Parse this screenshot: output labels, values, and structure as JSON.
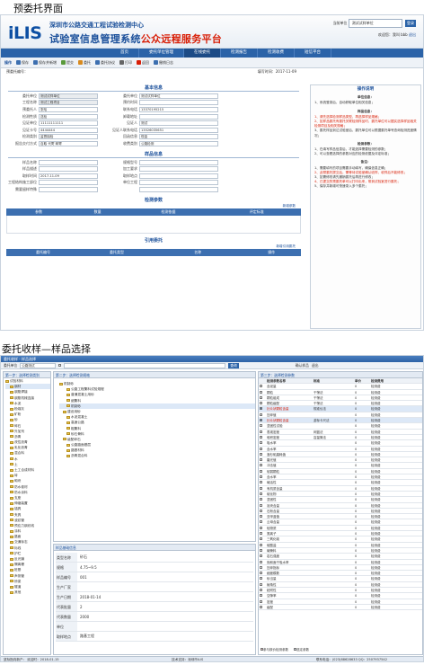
{
  "captions": {
    "screen1": "预委托界面",
    "screen2": "委托收样—样品选择"
  },
  "screen1": {
    "org_line1": "深圳市公路交通工程试验检测中心",
    "org_line2_a": "试验室信息管理系统",
    "org_line2_b": "公众远程服务平台",
    "logo": "iLIS",
    "topright": {
      "unit_label": "当前单位",
      "unit_value": "测试试样单位",
      "login_label": "登录",
      "user": "欢迎您：我叫 bbb",
      "logout": "退出"
    },
    "nav": [
      "首页",
      "委托单位管理",
      "在线委托",
      "检测报告",
      "检测收费",
      "短信平台"
    ],
    "toolbar": {
      "label": "操作",
      "buttons": [
        "保存",
        "保存并新增",
        "提交",
        "委托",
        "委托协议",
        "打印",
        "返回",
        "撤销日志"
      ]
    },
    "subbar": {
      "left_label": "预委托编号：",
      "right_label": "填写时间：",
      "right_value": "2017-11-09"
    },
    "basic": {
      "title": "基本信息",
      "rows": [
        [
          {
            "l": "委托单位",
            "v": "测试试样单位",
            "g": true
          },
          {
            "l": "委托单位",
            "v": "测试试样单位"
          }
        ],
        [
          {
            "l": "工程名称",
            "v": "测试工程项目",
            "g": true
          },
          {
            "l": "预约时间",
            "v": ""
          }
        ],
        [
          {
            "l": "预委托人",
            "v": "张哈"
          },
          {
            "l": "联系电话",
            "v": "13370195215"
          }
        ],
        [
          {
            "l": "检测性质",
            "v": "送检"
          },
          {
            "l": "卸载地址",
            "v": ""
          }
        ],
        [
          {
            "l": "见证单位",
            "v": "11111111111"
          },
          {
            "l": "见证人",
            "v": "测试"
          }
        ],
        [
          {
            "l": "见证卡号",
            "v": "4444444"
          },
          {
            "l": "见证人联系电话",
            "v": "13526035651"
          }
        ],
        [
          {
            "l": "检测类别",
            "v": "监督抽检"
          },
          {
            "l": "回函信息",
            "v": "现金"
          }
        ],
        [
          {
            "l": "报告交付方式",
            "v": "自取  代寄  邮寄"
          },
          {
            "l": "收费类别",
            "v": "公路检测"
          }
        ]
      ]
    },
    "sample": {
      "title": "样品信息",
      "rows": [
        [
          {
            "l": "样品名称",
            "v": ""
          },
          {
            "l": "规格型号",
            "v": ""
          }
        ],
        [
          {
            "l": "样品描述",
            "v": ""
          },
          {
            "l": "加工要求",
            "v": ""
          }
        ],
        [
          {
            "l": "取样时间",
            "v": "2017-11-09"
          },
          {
            "l": "取样地点",
            "v": ""
          }
        ],
        [
          {
            "l": "工程结构施工部位",
            "v": ""
          },
          {
            "l": "单位工程",
            "v": ""
          }
        ],
        [
          {
            "l": "需要留样特殊",
            "v": ""
          },
          {
            "l": "",
            "v": ""
          }
        ]
      ]
    },
    "params": {
      "title": "检测参数",
      "add": "新增参数",
      "headers": [
        "参数",
        "数量",
        "检测依据",
        "评定标准"
      ]
    },
    "refer": {
      "title": "引用委托",
      "add": "新增引用委托",
      "headers": [
        "委托编号",
        "委托类型",
        "名称",
        "操作"
      ]
    },
    "help": {
      "title": "操作说明",
      "sections": [
        {
          "t": "单位信息：",
          "lines": [
            {
              "x": "1、系统登录后，自动获取单位相关信息；",
              "r": false
            }
          ]
        },
        {
          "t": "样品信息：",
          "lines": [
            {
              "x": "1、请先选择检测样品类型，再选择样品规格；",
              "r": true
            },
            {
              "x": "2、如样品委托有委托关联检测样品时，委托单位可以据实选择样品相关检测项目及相关规格；",
              "r": true
            },
            {
              "x": "3、委托样品到达试验室后，委托单位可以根据委托单号查询检测进度情况；",
              "r": false
            }
          ]
        },
        {
          "t": "检测参数：",
          "lines": [
            {
              "x": "1、在填写样品信息后，才能选择需要检测的参数；",
              "r": false
            },
            {
              "x": "2、可以查看选择的参数对应的检测依据及评定标准；",
              "r": false
            }
          ]
        },
        {
          "t": "备注：",
          "lines": [
            {
              "x": "1、需要填写的项目需要手动填写，确保信息正确；",
              "r": false
            },
            {
              "x": "2、此预委托提交后，需等待试验室确认收样，收样后不能修改；",
              "r": true
            },
            {
              "x": "3、如需修改请先撤销委托后再进行修改；",
              "r": false
            },
            {
              "x": "4、已提交的预委托单可以打印出来，带到试验室进行委托；",
              "r": true
            },
            {
              "x": "5、保存并新增可快速录入多个委托；",
              "r": false
            }
          ]
        }
      ]
    }
  },
  "screen2": {
    "title": "委托收样 - 样品选择",
    "bar": {
      "unit_label": "委托单位",
      "unit": "公路测试",
      "search_btn": "查询",
      "confirm": "确认样品",
      "exit": "退出"
    },
    "pane1": {
      "title": "第一步：选择检测类别",
      "items": [
        "试验材料",
        "钢材",
        "钢筋焊接",
        "钢筋机械连接",
        "水泥",
        "粉煤灰",
        "矿粉",
        "砂",
        "碎石",
        "外加剂",
        "沥青",
        "改性沥青",
        "乳化沥青",
        "混合料",
        "水",
        "土",
        "土工合成材料",
        "砖",
        "砌块",
        "防水卷材",
        "防水涂料",
        "支座",
        "伸缩装置",
        "锚具",
        "夹具",
        "波纹管",
        "预应力钢绞线",
        "涂料",
        "路面",
        "交通标志",
        "标线",
        "护栏",
        "反光膜",
        "隔离栅",
        "桩基",
        "声测管",
        "桥梁",
        "隧道",
        "其他"
      ]
    },
    "pane2": {
      "title": "第二步：选择检测规格",
      "items": [
        "机制砂",
        "公路工程集料试验规程",
        "普通混凝土用砂",
        "细集料",
        "机制砂",
        "建设用砂",
        "水泥混凝土",
        "高速公路",
        "粗集料",
        "砂石骨料",
        "级配碎石",
        "公路路面基层",
        "路基材料",
        "沥青混合料"
      ]
    },
    "detail": {
      "title": "样品基础信息",
      "rows": [
        {
          "l": "类型名称",
          "v": "砂石"
        },
        {
          "l": "规格",
          "v": "4.75~9.5"
        },
        {
          "l": "样品编号",
          "v": "001"
        },
        {
          "l": "生产厂家",
          "v": ""
        },
        {
          "l": "生产日期",
          "v": "2018-01-14"
        },
        {
          "l": "代表批量",
          "v": "2"
        },
        {
          "l": "代表数量",
          "v": "2000"
        },
        {
          "l": "单位",
          "v": ""
        },
        {
          "l": "取样地点",
          "v": "路基工程"
        }
      ]
    },
    "pane3": {
      "title": "第三步：选择检测参数",
      "headers": [
        "",
        "检测参数名称",
        "标准",
        "单价",
        "检测费用"
      ],
      "rows": [
        {
          "n": "含泥量",
          "s": "",
          "p": "0",
          "c": "检测费",
          "on": false
        },
        {
          "n": "颗粒",
          "s": "干筛法",
          "p": "0",
          "c": "检测费",
          "on": false
        },
        {
          "n": "颗粒组成",
          "s": "干筛法",
          "p": "0",
          "c": "检测费",
          "on": false
        },
        {
          "n": "颗粒级配",
          "s": "干筛法",
          "p": "0",
          "c": "检测费",
          "on": false
        },
        {
          "n": "针片状颗粒含量",
          "s": "规准仪法",
          "p": "0",
          "c": "检测费",
          "on": true
        },
        {
          "n": "压碎值",
          "s": "",
          "p": "0",
          "c": "检测费",
          "on": false
        },
        {
          "n": "针片状颗粒含量",
          "s": "游标卡尺法",
          "p": "0",
          "c": "检测费",
          "on": true
        },
        {
          "n": "坚固性试验",
          "s": "",
          "p": "0",
          "c": "检测费",
          "on": false
        },
        {
          "n": "表观密度",
          "s": "网篮法",
          "p": "0",
          "c": "检测费",
          "on": false
        },
        {
          "n": "堆积密度",
          "s": "容量筒法",
          "p": "0",
          "c": "检测费",
          "on": false
        },
        {
          "n": "吸水率",
          "s": "",
          "p": "0",
          "c": "检测费",
          "on": false
        },
        {
          "n": "含水率",
          "s": "",
          "p": "0",
          "c": "检测费",
          "on": false
        },
        {
          "n": "洛杉矶磨耗值",
          "s": "",
          "p": "0",
          "c": "检测费",
          "on": false
        },
        {
          "n": "磨光值",
          "s": "",
          "p": "0",
          "c": "检测费",
          "on": false
        },
        {
          "n": "冲击值",
          "s": "",
          "p": "0",
          "c": "检测费",
          "on": false
        },
        {
          "n": "软弱颗粒",
          "s": "",
          "p": "0",
          "c": "检测费",
          "on": false
        },
        {
          "n": "含水率",
          "s": "",
          "p": "0",
          "c": "检测费",
          "on": false
        },
        {
          "n": "碱活性",
          "s": "",
          "p": "0",
          "c": "检测费",
          "on": false
        },
        {
          "n": "有机质含量",
          "s": "",
          "p": "0",
          "c": "检测费",
          "on": false
        },
        {
          "n": "硫化物",
          "s": "",
          "p": "0",
          "c": "检测费",
          "on": false
        },
        {
          "n": "坚固性",
          "s": "",
          "p": "0",
          "c": "检测费",
          "on": false
        },
        {
          "n": "泥块含量",
          "s": "",
          "p": "0",
          "c": "检测费",
          "on": false
        },
        {
          "n": "石粉含量",
          "s": "",
          "p": "0",
          "c": "检测费",
          "on": false
        },
        {
          "n": "亚甲蓝值",
          "s": "",
          "p": "0",
          "c": "检测费",
          "on": false
        },
        {
          "n": "云母含量",
          "s": "",
          "p": "0",
          "c": "检测费",
          "on": false
        },
        {
          "n": "轻物质",
          "s": "",
          "p": "0",
          "c": "检测费",
          "on": false
        },
        {
          "n": "氯离子",
          "s": "",
          "p": "0",
          "c": "检测费",
          "on": false
        },
        {
          "n": "三氧化硫",
          "s": "",
          "p": "0",
          "c": "检测费",
          "on": false
        },
        {
          "n": "硫酸盐",
          "s": "",
          "p": "0",
          "c": "检测费",
          "on": false
        },
        {
          "n": "碱骨料",
          "s": "",
          "p": "0",
          "c": "检测费",
          "on": false
        },
        {
          "n": "岩石强度",
          "s": "",
          "p": "0",
          "c": "检测费",
          "on": false
        },
        {
          "n": "饱和面干吸水率",
          "s": "",
          "p": "0",
          "c": "检测费",
          "on": false
        },
        {
          "n": "压碎指标",
          "s": "",
          "p": "0",
          "c": "检测费",
          "on": false
        },
        {
          "n": "细度模数",
          "s": "",
          "p": "0",
          "c": "检测费",
          "on": false
        },
        {
          "n": "砂当量",
          "s": "",
          "p": "0",
          "c": "检测费",
          "on": false
        },
        {
          "n": "棱角性",
          "s": "",
          "p": "0",
          "c": "检测费",
          "on": false
        },
        {
          "n": "粘附性",
          "s": "",
          "p": "0",
          "c": "检测费",
          "on": false
        },
        {
          "n": "空隙率",
          "s": "",
          "p": "0",
          "c": "检测费",
          "on": false
        },
        {
          "n": "密度",
          "s": "",
          "p": "0",
          "c": "检测费",
          "on": false
        },
        {
          "n": "级配",
          "s": "",
          "p": "0",
          "c": "检测费",
          "on": false
        }
      ],
      "legend": [
        "参与核价检测参数",
        "选定参数"
      ]
    },
    "status": {
      "left": "鼠标指向新户：  欢迎时：2018-01-15",
      "mid": "技术支持：深圳市iLIS",
      "right": "联系电话：(023)88628633 QQ：2507937542"
    }
  }
}
